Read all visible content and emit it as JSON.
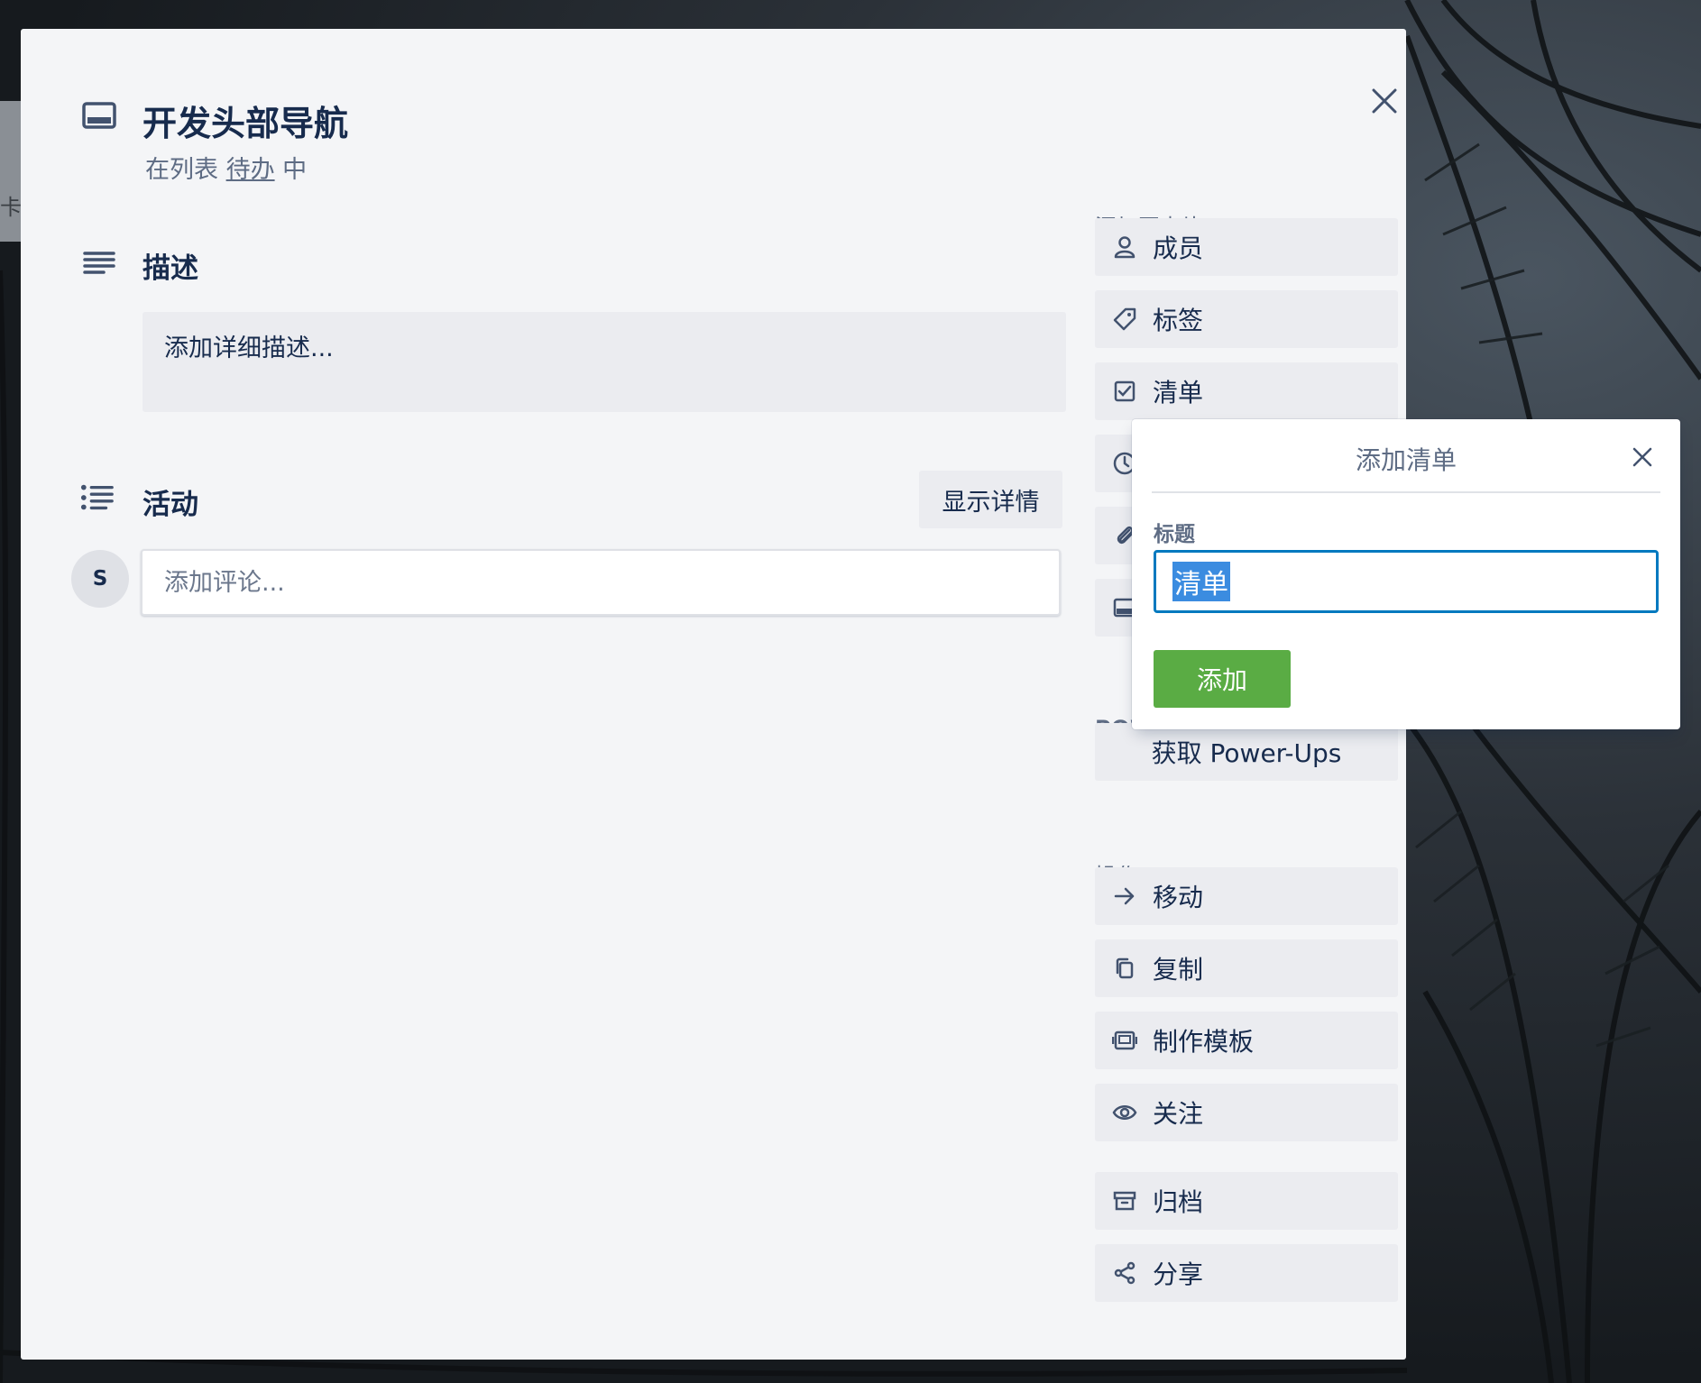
{
  "background": {
    "left_stub_text": "卡"
  },
  "card": {
    "title": "开发头部导航",
    "list_prefix": "在列表 ",
    "list_name": "待办",
    "list_suffix": " 中",
    "description": {
      "heading": "描述",
      "placeholder": "添加详细描述..."
    },
    "activity": {
      "heading": "活动",
      "show_details_label": "显示详情",
      "avatar_initial": "S",
      "comment_placeholder": "添加评论..."
    }
  },
  "sidebar": {
    "add_to_card_label": "添加至卡片",
    "add_items": [
      {
        "label": "成员",
        "icon": "person-icon"
      },
      {
        "label": "标签",
        "icon": "tag-icon"
      },
      {
        "label": "清单",
        "icon": "checklist-icon"
      },
      {
        "label": "",
        "icon": "clock-icon"
      },
      {
        "label": "",
        "icon": "paperclip-icon"
      },
      {
        "label": "",
        "icon": "card-cover-icon"
      }
    ],
    "powerups_label": "POWE",
    "get_powerups_label": "获取 Power-Ups",
    "actions_label": "操作",
    "actions": [
      {
        "label": "移动",
        "icon": "arrow-right-icon"
      },
      {
        "label": "复制",
        "icon": "copy-icon"
      },
      {
        "label": "制作模板",
        "icon": "template-icon"
      },
      {
        "label": "关注",
        "icon": "eye-icon"
      }
    ],
    "more_actions": [
      {
        "label": "归档",
        "icon": "archive-icon"
      },
      {
        "label": "分享",
        "icon": "share-icon"
      }
    ]
  },
  "popover": {
    "title": "添加清单",
    "field_label": "标题",
    "field_value": "清单",
    "add_button_label": "添加"
  },
  "colors": {
    "primary_text": "#172b4d",
    "secondary_text": "#5e6c84",
    "card_bg": "#f4f5f7",
    "button_bg": "#ebecf0",
    "focus_blue": "#0079bf",
    "selection_blue": "#3b8ce0",
    "add_green": "#5aac44"
  }
}
